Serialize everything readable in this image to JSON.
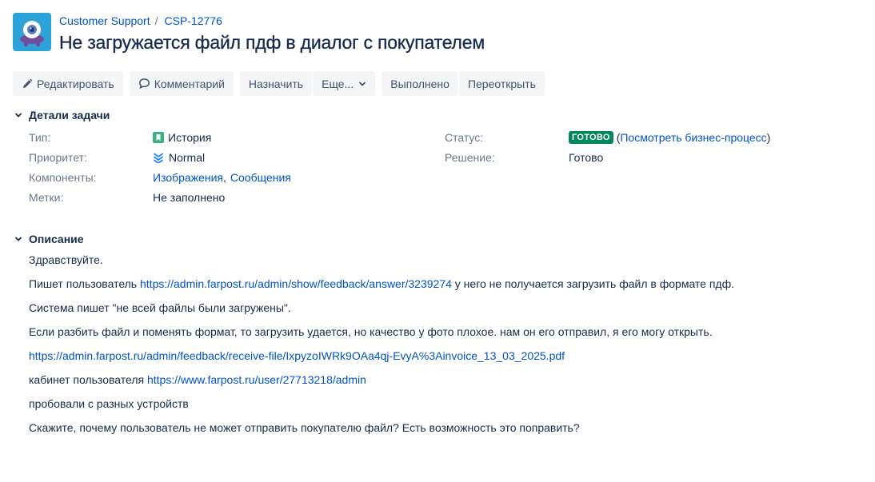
{
  "breadcrumb": {
    "project": "Customer Support",
    "separator": "/",
    "issue_key": "CSP-12776"
  },
  "issue": {
    "title": "Не загружается файл пдф в диалог с покупателем"
  },
  "toolbar": {
    "edit": "Редактировать",
    "comment": "Комментарий",
    "assign": "Назначить",
    "more": "Еще...",
    "done": "Выполнено",
    "reopen": "Переоткрыть"
  },
  "details": {
    "heading": "Детали задачи",
    "type_label": "Тип:",
    "type_value": "История",
    "priority_label": "Приоритет:",
    "priority_value": "Normal",
    "components_label": "Компоненты:",
    "component_1": "Изображения",
    "component_sep": ",",
    "component_2": "Сообщения",
    "labels_label": "Метки:",
    "labels_value": "Не заполнено",
    "status_label": "Статус:",
    "status_value": "ГОТОВО",
    "paren_open": "(",
    "workflow_link": "Посмотреть бизнес-процесс",
    "paren_close": ")",
    "resolution_label": "Решение:",
    "resolution_value": "Готово"
  },
  "description": {
    "heading": "Описание",
    "line1": "Здравствуйте.",
    "line2_prefix": "Пишет пользователь ",
    "line2_link": "https://admin.farpost.ru/admin/show/feedback/answer/3239274",
    "line2_suffix": " у него не получается загрузить файл в формате пдф.",
    "line3": "Система пишет \"не всей файлы были загружены\".",
    "line4": "Если разбить файл и поменять формат, то загрузить удается, но качество у фото плохое. нам он его отправил, я его могу открыть.",
    "line5_link": "https://admin.farpost.ru/admin/feedback/receive-file/IxpyzoIWRk9OAa4qj-EvyA%3Ainvoice_13_03_2025.pdf",
    "line6_prefix": "кабинет пользователя ",
    "line6_link": "https://www.farpost.ru/user/27713218/admin",
    "line7": "пробовали с разных устройств",
    "line8": "Скажите, почему пользователь не может отправить покупателю файл? Есть возможность это поправить?"
  },
  "colors": {
    "link": "#0052cc",
    "text": "#172b4d",
    "muted": "#6b778c",
    "button_bg": "#f4f5f7",
    "status_green": "#00875a",
    "avatar_bg": "#2ea3d8"
  },
  "icons": [
    "project-avatar-icon",
    "pencil-icon",
    "comment-icon",
    "chevron-down-icon",
    "story-icon",
    "priority-normal-icon"
  ]
}
